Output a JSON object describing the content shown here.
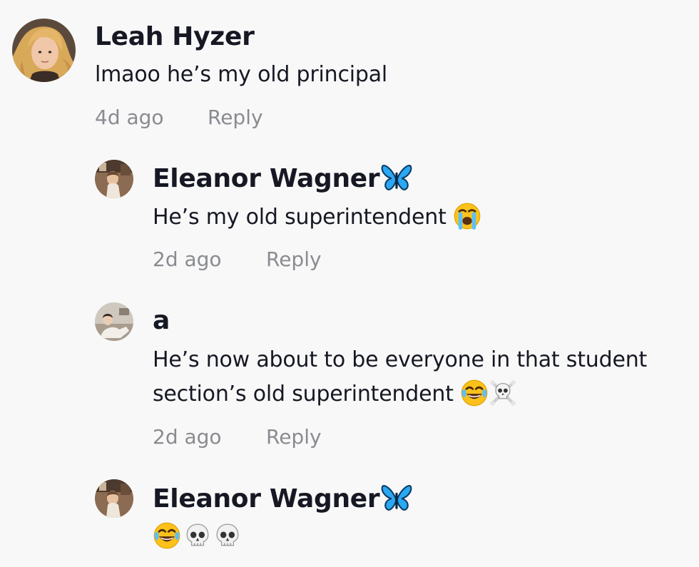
{
  "comments": [
    {
      "author": "Leah Hyzer",
      "text": "lmaoo he’s my old principal",
      "time": "4d ago",
      "reply_label": "Reply"
    },
    {
      "author": "Eleanor Wagner",
      "author_badge_icon": "butterfly-icon",
      "text": "He’s my old superintendent",
      "text_emojis": [
        "loudly-crying-face-icon"
      ],
      "time": "2d ago",
      "reply_label": "Reply"
    },
    {
      "author": "a",
      "text_line1": "He’s now about to be everyone in that student",
      "text_line2": "section’s old superintendent",
      "text_emojis": [
        "tears-of-joy-icon",
        "skull-and-crossbones-icon"
      ],
      "time": "2d ago",
      "reply_label": "Reply"
    },
    {
      "author": "Eleanor Wagner",
      "author_badge_icon": "butterfly-icon",
      "text_emojis": [
        "tears-of-joy-icon",
        "skull-icon",
        "skull-icon"
      ]
    }
  ],
  "colors": {
    "background": "#f8f8f8",
    "primary_text": "#161823",
    "secondary_text": "#8a8b91",
    "butterfly": "#2aa8f2"
  }
}
